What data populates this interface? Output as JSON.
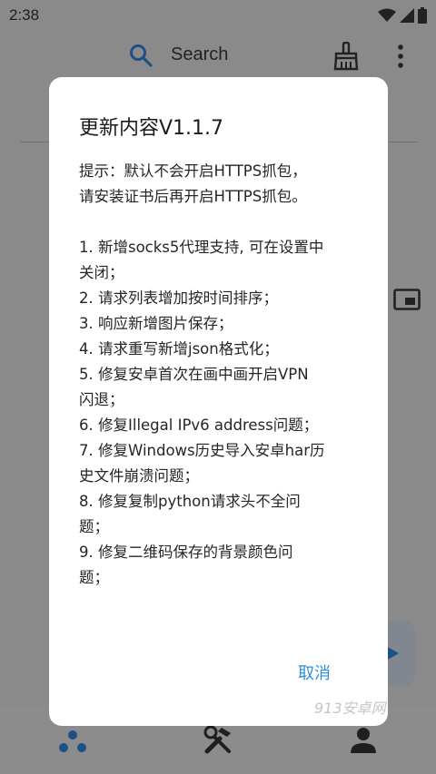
{
  "status_bar": {
    "time": "2:38"
  },
  "toolbar": {
    "search_label": "Search"
  },
  "dialog": {
    "title": "更新内容V1.1.7",
    "lines": [
      "提示：默认不会开启HTTPS抓包，",
      "请安装证书后再开启HTTPS抓包。",
      "",
      "1. 新增socks5代理支持, 可在设置中",
      "关闭；",
      "2. 请求列表增加按时间排序；",
      "3. 响应新增图片保存；",
      "4. 请求重写新增json格式化；",
      "5. 修复安卓首次在画中画开启VPN",
      "闪退；",
      "6. 修复Illegal IPv6 address问题；",
      "7. 修复Windows历史导入安卓har历",
      "史文件崩溃问题；",
      "8. 修复复制python请求头不全问",
      "题；",
      "9. 修复二维码保存的背景颜色问",
      "题；"
    ],
    "cancel_label": "取消"
  },
  "watermark": "913安卓网",
  "colors": {
    "accent": "#2f8fd8",
    "scrim": "#8a8a8a",
    "dialog_bg": "#ffffff"
  },
  "icons": [
    "search-icon",
    "broom-icon",
    "more-vert-icon",
    "pip-icon",
    "send-arrow-icon",
    "home-bubbles-icon",
    "tools-icon",
    "user-icon"
  ]
}
